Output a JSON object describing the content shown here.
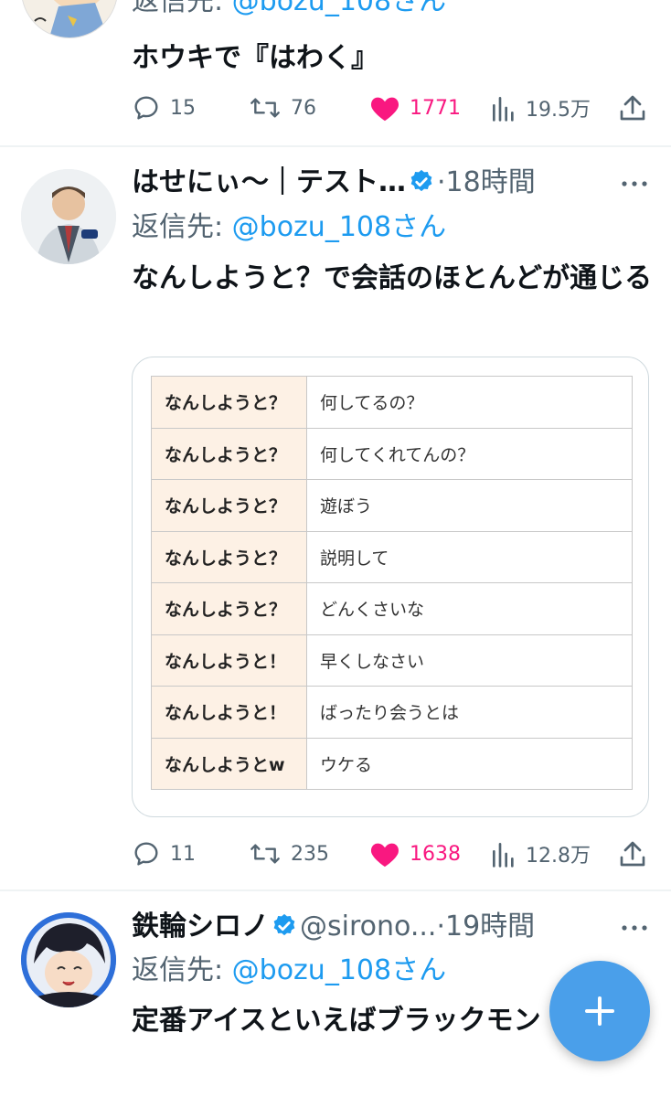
{
  "tweets": [
    {
      "reply_prefix": "返信先: ",
      "reply_handle": "@bozu_108さん",
      "text": "ホウキで『はわく』",
      "actions": {
        "replies": "15",
        "retweets": "76",
        "likes": "1771",
        "views": "19.5万"
      }
    },
    {
      "name": "はせにぃ～｜テスト…",
      "time": "·18時間",
      "reply_prefix": "返信先: ",
      "reply_handle": "@bozu_108さん",
      "text": "なんしようと？で会話のほとんどが通じる",
      "table": [
        {
          "key": "なんしようと？",
          "value": "何してるの？"
        },
        {
          "key": "なんしようと？",
          "value": "何してくれてんの？"
        },
        {
          "key": "なんしようと？",
          "value": "遊ぼう"
        },
        {
          "key": "なんしようと？",
          "value": "説明して"
        },
        {
          "key": "なんしようと？",
          "value": "どんくさいな"
        },
        {
          "key": "なんしようと！",
          "value": "早くしなさい"
        },
        {
          "key": "なんしようと！",
          "value": "ばったり会うとは"
        },
        {
          "key": "なんしようとw",
          "value": "ウケる"
        }
      ],
      "actions": {
        "replies": "11",
        "retweets": "235",
        "likes": "1638",
        "views": "12.8万"
      }
    },
    {
      "name": "鉄輪シロノ",
      "handle": "@sirono...",
      "time": "·19時間",
      "reply_prefix": "返信先: ",
      "reply_handle": "@bozu_108さん",
      "text": "定番アイスといえばブラックモン"
    }
  ],
  "colors": {
    "accent": "#1d9bf0",
    "like": "#f91880",
    "muted": "#536471",
    "fab": "#4a9fea",
    "table_key_bg": "#fdf1e5"
  },
  "icons": [
    "reply-icon",
    "retweet-icon",
    "like-icon",
    "views-icon",
    "share-icon",
    "more-icon",
    "verified-badge-icon",
    "compose-plus-icon"
  ]
}
